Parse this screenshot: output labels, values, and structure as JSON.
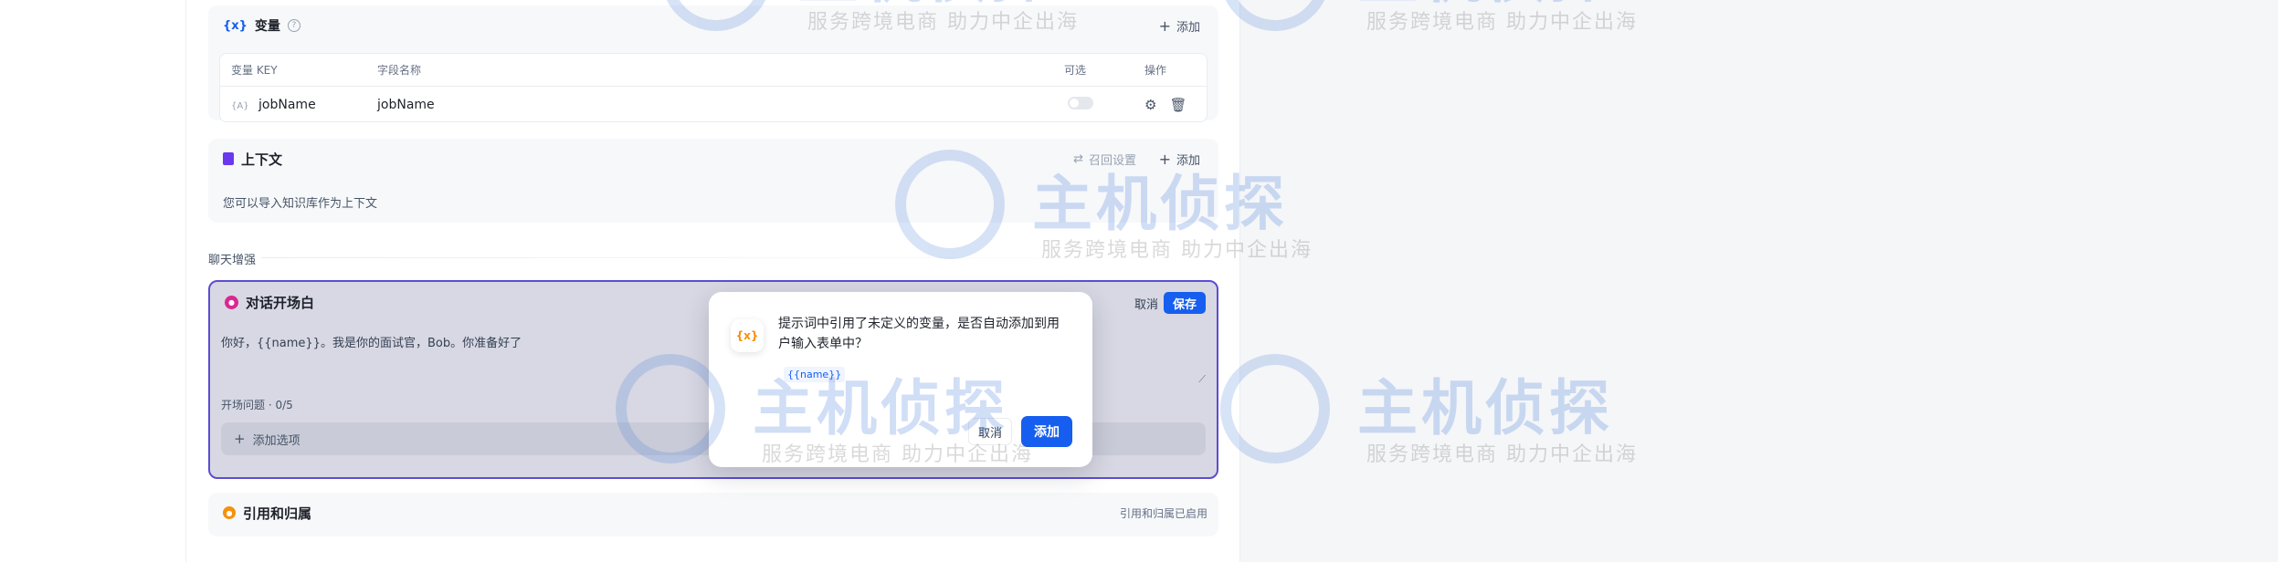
{
  "variables": {
    "title": "变量",
    "icon": "{x}",
    "help": "?",
    "add_label": "添加",
    "columns": {
      "key": "变量 KEY",
      "name": "字段名称",
      "optional": "可选",
      "ops": "操作"
    },
    "rows": [
      {
        "key_icon": "{A}",
        "key": "jobName",
        "name": "jobName",
        "optional": false
      }
    ]
  },
  "context": {
    "title": "上下文",
    "retrieve_label": "召回设置",
    "add_label": "添加",
    "description": "您可以导入知识库作为上下文"
  },
  "chat_enhance": {
    "label": "聊天增强"
  },
  "opening": {
    "title": "对话开场白",
    "cancel_label": "取消",
    "save_label": "保存",
    "text": "你好，{{name}}。我是你的面试官，Bob。你准备好了",
    "questions_label": "开场问题 · 0/5",
    "add_option_label": "添加选项"
  },
  "citation": {
    "title": "引用和归属",
    "status": "引用和归属已启用"
  },
  "dialog": {
    "icon": "{x}",
    "message": "提示词中引用了未定义的变量，是否自动添加到用户输入表单中？",
    "variable": "{{name}}",
    "cancel_label": "取消",
    "add_label": "添加"
  },
  "watermark": {
    "brand": "主机侦探",
    "sub": "服务跨境电商  助力中企出海"
  },
  "colors": {
    "primary": "#155eef",
    "focus_border": "#5b4dd2",
    "warning": "#f79009"
  }
}
